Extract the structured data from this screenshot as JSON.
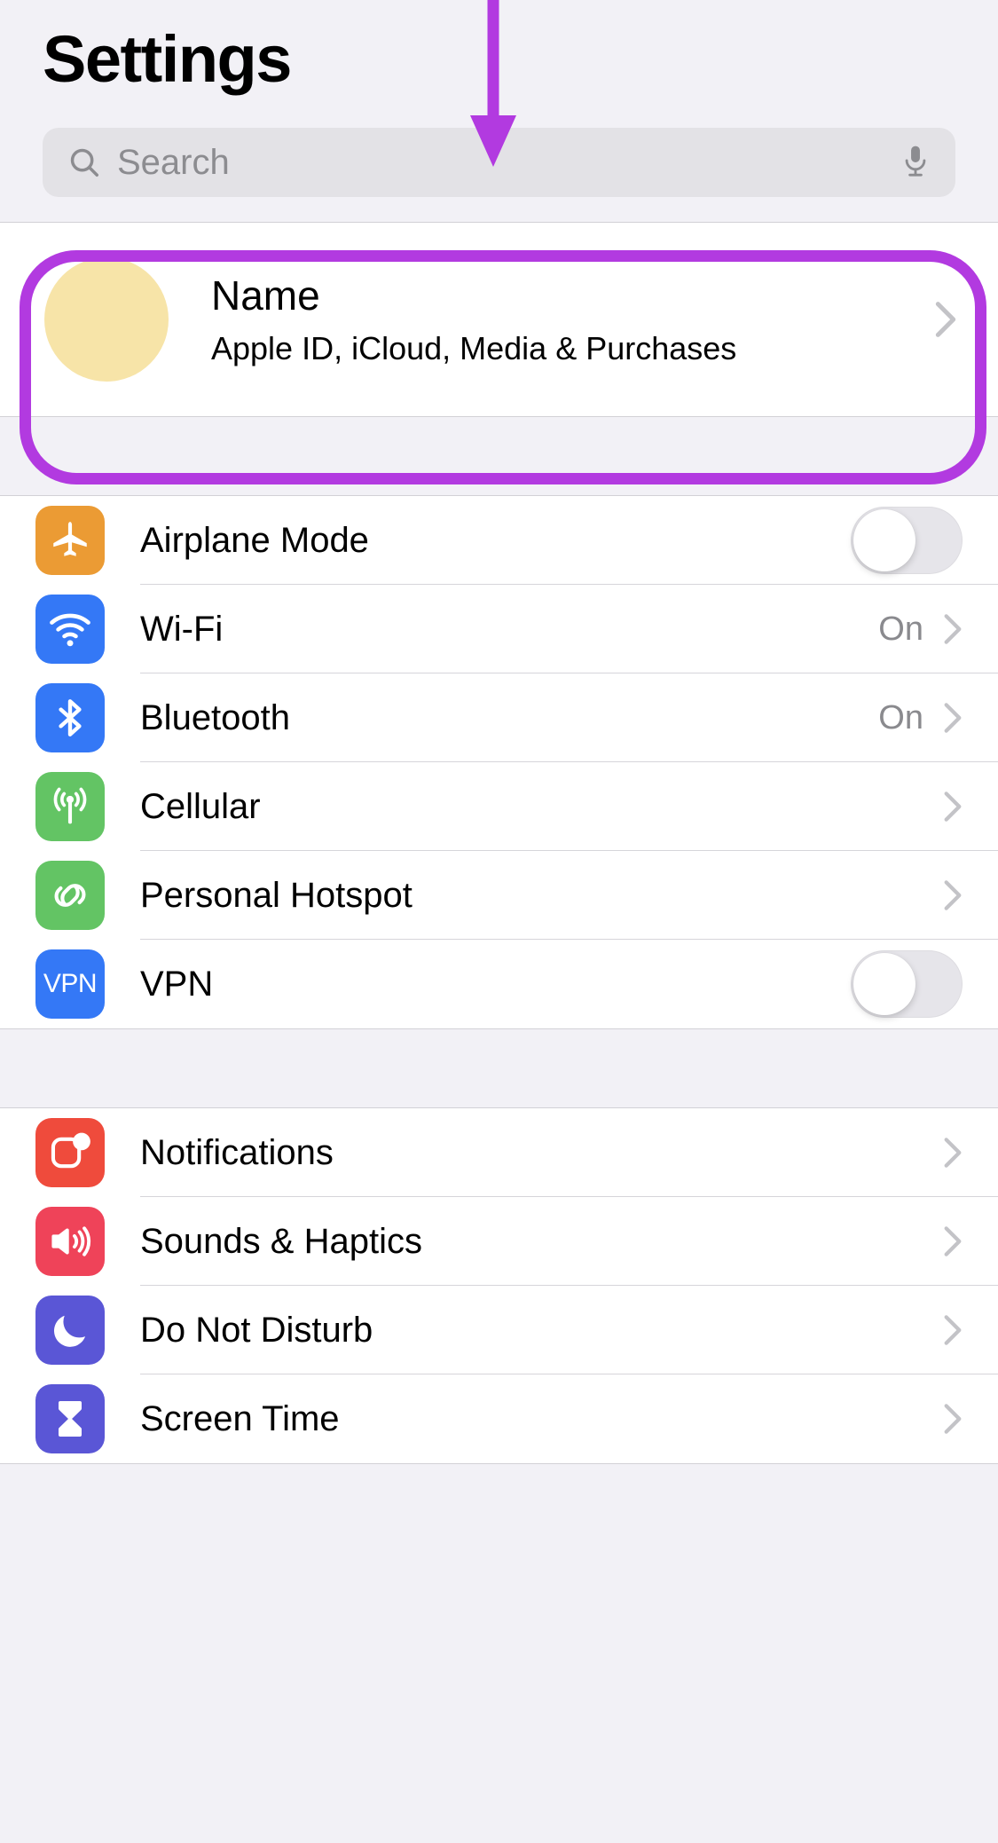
{
  "header": {
    "title": "Settings"
  },
  "search": {
    "placeholder": "Search",
    "icon": "search-icon",
    "mic_icon": "microphone-icon"
  },
  "account": {
    "name": "Name",
    "subtitle": "Apple ID, iCloud, Media & Purchases",
    "avatar_color": "#f7e4a8",
    "chevron": "chevron-right-icon"
  },
  "annotations": {
    "color": "#b23ae0",
    "arrow": "down-arrow-annotation",
    "highlight": "rounded-rectangle-highlight",
    "target": "apple-id-row"
  },
  "groups": [
    {
      "name": "connectivity",
      "rows": [
        {
          "label": "Airplane Mode",
          "icon": "airplane-icon",
          "icon_color": "#eb9b34",
          "control": "toggle",
          "toggle_on": false,
          "value": ""
        },
        {
          "label": "Wi-Fi",
          "icon": "wifi-icon",
          "icon_color": "#3478f6",
          "control": "chevron",
          "value": "On"
        },
        {
          "label": "Bluetooth",
          "icon": "bluetooth-icon",
          "icon_color": "#3478f6",
          "control": "chevron",
          "value": "On"
        },
        {
          "label": "Cellular",
          "icon": "cellular-antenna-icon",
          "icon_color": "#63c464",
          "control": "chevron",
          "value": ""
        },
        {
          "label": "Personal Hotspot",
          "icon": "hotspot-link-icon",
          "icon_color": "#63c464",
          "control": "chevron",
          "value": ""
        },
        {
          "label": "VPN",
          "icon": "vpn-icon",
          "icon_color": "#3478f6",
          "control": "toggle",
          "toggle_on": false,
          "value": ""
        }
      ]
    },
    {
      "name": "notifications-sounds",
      "rows": [
        {
          "label": "Notifications",
          "icon": "notification-badge-icon",
          "icon_color": "#ef4b3c",
          "control": "chevron",
          "value": ""
        },
        {
          "label": "Sounds & Haptics",
          "icon": "speaker-waves-icon",
          "icon_color": "#ef4359",
          "control": "chevron",
          "value": ""
        },
        {
          "label": "Do Not Disturb",
          "icon": "moon-icon",
          "icon_color": "#5a56d6",
          "control": "chevron",
          "value": ""
        },
        {
          "label": "Screen Time",
          "icon": "hourglass-icon",
          "icon_color": "#5a56d6",
          "control": "chevron",
          "value": ""
        }
      ]
    }
  ]
}
